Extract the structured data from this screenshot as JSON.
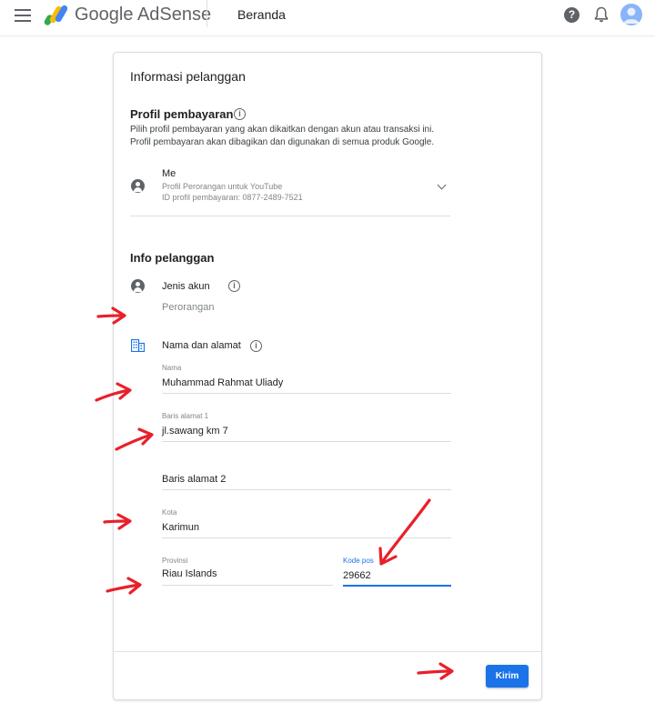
{
  "header": {
    "brand": "Google AdSense",
    "page_name": "Beranda",
    "help_glyph": "?"
  },
  "card": {
    "title": "Informasi pelanggan",
    "payment_profile": {
      "heading": "Profil pembayaran",
      "desc_line1": "Pilih profil pembayaran yang akan dikaitkan dengan akun atau transaksi ini.",
      "desc_line2": "Profil pembayaran akan dibagikan dan digunakan di semua produk Google.",
      "name": "Me",
      "type": "Profil Perorangan untuk YouTube",
      "id_text": "ID profil pembayaran: 0877-2489-7521"
    },
    "customer_info": {
      "heading": "Info pelanggan",
      "account_type_label": "Jenis akun",
      "account_type_value": "Perorangan",
      "name_address_label": "Nama dan alamat",
      "fields": {
        "name_label": "Nama",
        "name_value": "Muhammad Rahmat Uliady",
        "address1_label": "Baris alamat 1",
        "address1_value": "jl.sawang km 7",
        "address2_placeholder": "Baris alamat 2",
        "city_label": "Kota",
        "city_value": "Karimun",
        "province_label": "Provinsi",
        "province_value": "Riau Islands",
        "postal_label": "Kode pos",
        "postal_value": "29662"
      }
    },
    "submit_label": "Kirim"
  },
  "colors": {
    "accent": "#1a73e8",
    "annotation_red": "#e8202a"
  },
  "icons": [
    "menu-icon",
    "adsense-logo-icon",
    "help-icon",
    "bell-icon",
    "avatar",
    "info-icon",
    "person-icon",
    "chevron-down-icon",
    "building-icon"
  ]
}
